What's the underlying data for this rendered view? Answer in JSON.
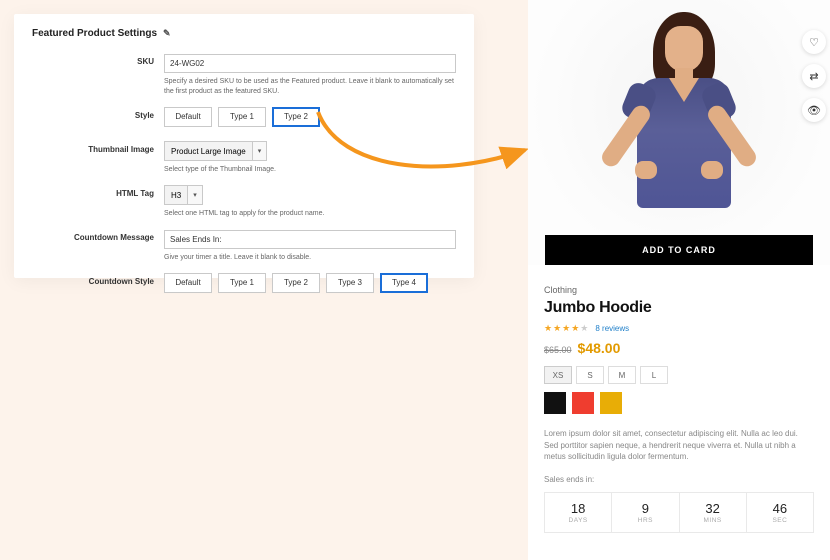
{
  "admin": {
    "title": "Featured Product Settings",
    "edit_icon": "✎",
    "fields": {
      "sku": {
        "label": "SKU",
        "value": "24-WG02",
        "help": "Specify a desired SKU to be used as the Featured product. Leave it blank to automatically set the first product as the featured SKU."
      },
      "style": {
        "label": "Style",
        "options": [
          "Default",
          "Type 1",
          "Type 2"
        ],
        "selected": "Type 2"
      },
      "thumbnail": {
        "label": "Thumbnail Image",
        "value": "Product Large Image",
        "help": "Select type of the Thumbnail Image."
      },
      "html_tag": {
        "label": "HTML Tag",
        "value": "H3",
        "help": "Select one HTML tag to apply for the product name."
      },
      "countdown_msg": {
        "label": "Countdown Message",
        "value": "Sales Ends In:",
        "help": "Give your timer a title. Leave it blank to disable."
      },
      "countdown_style": {
        "label": "Countdown Style",
        "options": [
          "Default",
          "Type 1",
          "Type 2",
          "Type 3",
          "Type 4"
        ],
        "selected": "Type 4"
      }
    }
  },
  "icons": {
    "caret": "▾",
    "heart": "♡",
    "compare": "⇄",
    "eye": "👁"
  },
  "product": {
    "addcart_label": "ADD TO CARD",
    "category": "Clothing",
    "name": "Jumbo Hoodie",
    "rating_value": 4,
    "review_count_text": "8 reviews",
    "old_price": "$65.00",
    "new_price": "$48.00",
    "sizes": [
      "XS",
      "S",
      "M",
      "L"
    ],
    "size_selected": "XS",
    "swatches": [
      "black",
      "red",
      "gold"
    ],
    "description": "Lorem ipsum dolor sit amet, consectetur adipiscing elit. Nulla ac leo dui. Sed porttitor sapien neque, a hendrerit neque viverra et. Nulla ut nibh a metus sollicitudin ligula dolor fermentum.",
    "sale_label": "Sales ends in:",
    "countdown": {
      "days": {
        "value": "18",
        "unit": "DAYS"
      },
      "hrs": {
        "value": "9",
        "unit": "HRS"
      },
      "mins": {
        "value": "32",
        "unit": "MINS"
      },
      "sec": {
        "value": "46",
        "unit": "SEC"
      }
    }
  }
}
